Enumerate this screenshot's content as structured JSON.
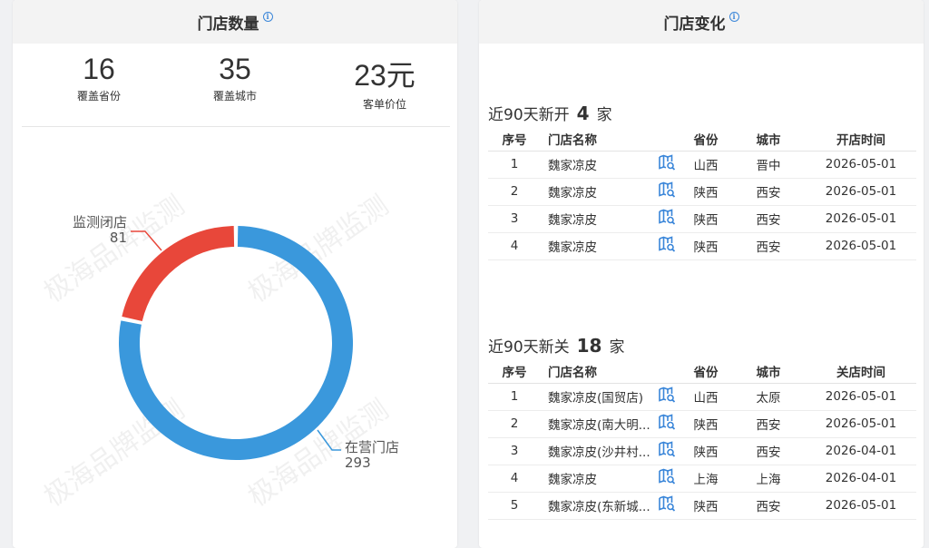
{
  "store_count": {
    "title": "门店数量",
    "info_glyph": "i",
    "stats": [
      {
        "value": "16",
        "label": "覆盖省份"
      },
      {
        "value": "35",
        "label": "覆盖城市"
      },
      {
        "value": "23元",
        "label": "客单价位"
      }
    ],
    "watermark": "极海品牌监测"
  },
  "chart_data": {
    "type": "pie",
    "variant": "donut",
    "categories": [
      "在营门店",
      "监测闭店"
    ],
    "values": [
      293,
      81
    ],
    "value_labels": [
      "293",
      "81"
    ],
    "colors": [
      "#3a98dc",
      "#e8473a"
    ]
  },
  "store_change": {
    "title": "门店变化",
    "info_glyph": "i",
    "opened": {
      "prefix": "近90天新开",
      "count": "4",
      "unit": "家",
      "headers": [
        "序号",
        "门店名称",
        "",
        "省份",
        "城市",
        "开店时间"
      ],
      "rows": [
        {
          "idx": "1",
          "name": "魏家凉皮",
          "province": "山西",
          "city": "晋中",
          "date": "2026-05-01"
        },
        {
          "idx": "2",
          "name": "魏家凉皮",
          "province": "陕西",
          "city": "西安",
          "date": "2026-05-01"
        },
        {
          "idx": "3",
          "name": "魏家凉皮",
          "province": "陕西",
          "city": "西安",
          "date": "2026-05-01"
        },
        {
          "idx": "4",
          "name": "魏家凉皮",
          "province": "陕西",
          "city": "西安",
          "date": "2026-05-01"
        }
      ]
    },
    "closed": {
      "prefix": "近90天新关",
      "count": "18",
      "unit": "家",
      "headers": [
        "序号",
        "门店名称",
        "",
        "省份",
        "城市",
        "关店时间"
      ],
      "rows": [
        {
          "idx": "1",
          "name": "魏家凉皮(国贸店)",
          "province": "山西",
          "city": "太原",
          "date": "2026-05-01"
        },
        {
          "idx": "2",
          "name": "魏家凉皮(南大明...",
          "province": "陕西",
          "city": "西安",
          "date": "2026-05-01"
        },
        {
          "idx": "3",
          "name": "魏家凉皮(沙井村...",
          "province": "陕西",
          "city": "西安",
          "date": "2026-04-01"
        },
        {
          "idx": "4",
          "name": "魏家凉皮",
          "province": "上海",
          "city": "上海",
          "date": "2026-04-01"
        },
        {
          "idx": "5",
          "name": "魏家凉皮(东新城...",
          "province": "陕西",
          "city": "西安",
          "date": "2026-05-01"
        }
      ]
    },
    "map_icon": "map-search-icon",
    "icon_color": "#3a86d9"
  }
}
